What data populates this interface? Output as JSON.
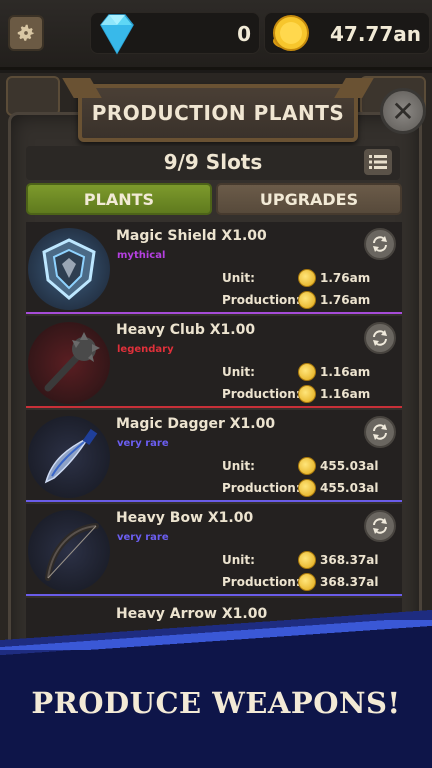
{
  "resources": {
    "gems": "0",
    "gold": "47.77an"
  },
  "panel": {
    "title": "PRODUCTION PLANTS",
    "slots": "9/9 Slots",
    "tabs": {
      "plants": "PLANTS",
      "upgrades": "UPGRADES"
    },
    "active_tab": "PLANTS",
    "close_glyph": "✕"
  },
  "labels": {
    "unit": "Unit:",
    "production": "Production:"
  },
  "items": [
    {
      "name": "Magic Shield X1.00",
      "rarity": "mythical",
      "rarity_color": "#b440e0",
      "unit": "1.76am",
      "production": "1.76am",
      "icon": "shield-icon",
      "accent": "#a64cd8"
    },
    {
      "name": "Heavy Club X1.00",
      "rarity": "legendary",
      "rarity_color": "#e0303a",
      "unit": "1.16am",
      "production": "1.16am",
      "icon": "club-icon",
      "accent": "#c83038"
    },
    {
      "name": "Magic Dagger X1.00",
      "rarity": "very rare",
      "rarity_color": "#6b5ef0",
      "unit": "455.03al",
      "production": "455.03al",
      "icon": "dagger-icon",
      "accent": "#6a5ce8"
    },
    {
      "name": "Heavy Bow X1.00",
      "rarity": "very rare",
      "rarity_color": "#6b5ef0",
      "unit": "368.37al",
      "production": "368.37al",
      "icon": "bow-icon",
      "accent": "#6a5ce8"
    }
  ],
  "partial_item": {
    "name": "Heavy Arrow X1.00"
  },
  "promo": {
    "text": "PRODUCE WEAPONS!"
  },
  "colors": {
    "tab_active": "#7d9a2c",
    "tab_inactive": "#6b5b49",
    "promo_blue": "#1e2c80"
  }
}
